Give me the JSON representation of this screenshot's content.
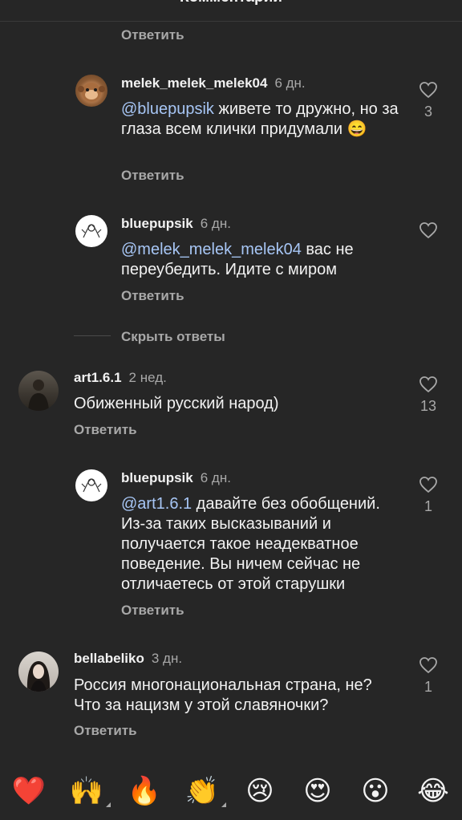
{
  "header": {
    "title": "Комментарии"
  },
  "reply_label": "Ответить",
  "hide_replies_label": "Скрыть ответы",
  "comments": [
    {
      "username": "melek_melek_melek04",
      "time": "6 дн.",
      "mention": "@bluepupsik",
      "text": " живете то дружно, но за глаза всем клички придумали 😄",
      "likes": "3"
    },
    {
      "username": "bluepupsik",
      "time": "6 дн.",
      "mention": "@melek_melek_melek04",
      "text": " вас не переубедить. Идите с миром",
      "likes": ""
    },
    {
      "username": "art1.6.1",
      "time": "2 нед.",
      "mention": "",
      "text": "Обиженный русский народ)",
      "likes": "13"
    },
    {
      "username": "bluepupsik",
      "time": "6 дн.",
      "mention": "@art1.6.1",
      "text": " давайте без обобщений. Из-за таких высказываний и получается такое неадекватное поведение. Вы ничем сейчас не отличаетесь от этой старушки",
      "likes": "1"
    },
    {
      "username": "bellabeliko",
      "time": "3 дн.",
      "mention": "",
      "text": "Россия многонациональная страна, не? Что за нацизм у этой славяночки?",
      "likes": "1"
    }
  ],
  "emoji_bar": [
    "❤️",
    "🙌",
    "🔥",
    "👏",
    "😢",
    "😍",
    "😮",
    "😂"
  ],
  "colors": {
    "background": "#262626",
    "mention": "#a7c6f5",
    "secondary_text": "#a8a8a8",
    "text": "#f2f2f2"
  }
}
